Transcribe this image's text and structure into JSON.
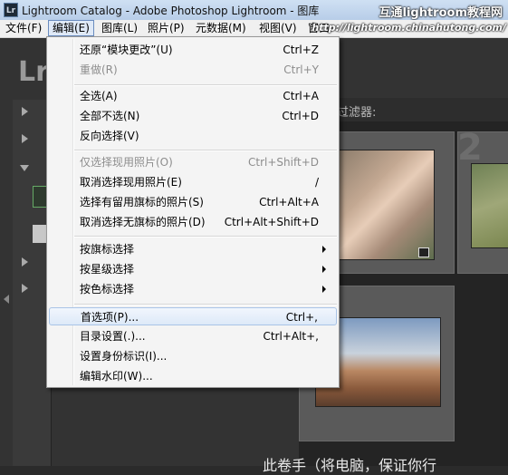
{
  "window": {
    "app_icon": "Lr",
    "title": "Lightroom Catalog - Adobe Photoshop Lightroom - 图库",
    "watermark": "互通lightroom教程网",
    "url_watermark": "http://lightroom.chinahutong.com/"
  },
  "menubar": {
    "items": [
      "文件(F)",
      "编辑(E)",
      "图库(L)",
      "照片(P)",
      "元数据(M)",
      "视图(V)",
      "窗口"
    ]
  },
  "edit_menu": {
    "items": [
      {
        "label": "还原“模块更改”(U)",
        "shortcut": "Ctrl+Z"
      },
      {
        "label": "重做(R)",
        "shortcut": "Ctrl+Y"
      },
      {
        "label": "全选(A)",
        "shortcut": "Ctrl+A"
      },
      {
        "label": "全部不选(N)",
        "shortcut": "Ctrl+D"
      },
      {
        "label": "反向选择(V)",
        "shortcut": ""
      },
      {
        "label": "仅选择现用照片(O)",
        "shortcut": "Ctrl+Shift+D"
      },
      {
        "label": "取消选择现用照片(E)",
        "shortcut": "/"
      },
      {
        "label": "选择有留用旗标的照片(S)",
        "shortcut": "Ctrl+Alt+A"
      },
      {
        "label": "取消选择无旗标的照片(D)",
        "shortcut": "Ctrl+Alt+Shift+D"
      },
      {
        "label": "按旗标选择",
        "shortcut": ""
      },
      {
        "label": "按星级选择",
        "shortcut": ""
      },
      {
        "label": "按色标选择",
        "shortcut": ""
      },
      {
        "label": "首选项(P)...",
        "shortcut": "Ctrl+,"
      },
      {
        "label": "目录设置(.)...",
        "shortcut": "Ctrl+Alt+,"
      },
      {
        "label": "设置身份标识(I)...",
        "shortcut": ""
      },
      {
        "label": "编辑水印(W)...",
        "shortcut": ""
      }
    ]
  },
  "background": {
    "logo": "Lr",
    "filter_label": "过滤器:",
    "grid_number": "2",
    "bottom_caption": "此卷手（将电脑，保证你行"
  }
}
